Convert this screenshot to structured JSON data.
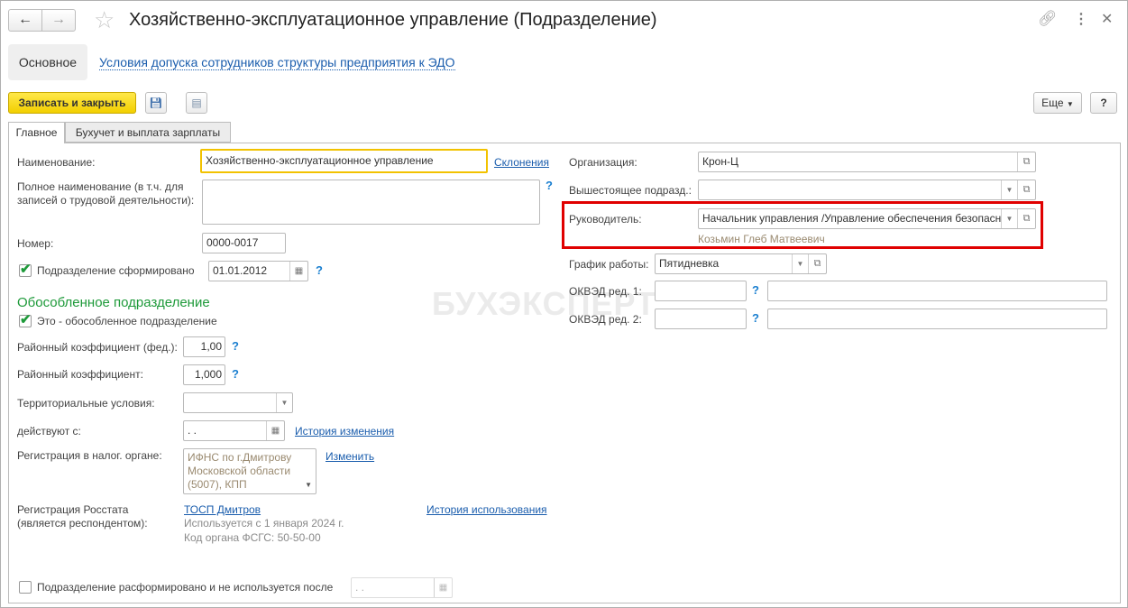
{
  "window": {
    "title": "Хозяйственно-эксплуатационное управление (Подразделение)"
  },
  "nav": {
    "main": "Основное",
    "link": "Условия допуска сотрудников структуры предприятия к ЭДО"
  },
  "toolbar": {
    "save_close": "Записать и закрыть",
    "more": "Еще",
    "help": "?"
  },
  "tabs": [
    {
      "label": "Главное"
    },
    {
      "label": "Бухучет и выплата зарплаты"
    }
  ],
  "left": {
    "name_label": "Наименование:",
    "name_value": "Хозяйственно-эксплуатационное управление",
    "declensions": "Склонения",
    "fullname_label1": "Полное наименование (в т.ч. для",
    "fullname_label2": "записей о трудовой деятельности):",
    "fullname_value": "",
    "number_label": "Номер:",
    "number_value": "0000-0017",
    "formed_label": "Подразделение сформировано",
    "formed_date": "01.01.2012",
    "section_title": "Обособленное подразделение",
    "separate_label": "Это - обособленное подразделение",
    "coef_fed_label": "Районный коэффициент (фед.):",
    "coef_fed_value": "1,00",
    "coef_label": "Районный коэффициент:",
    "coef_value": "1,000",
    "terr_label": "Территориальные условия:",
    "terr_value": "",
    "from_label": "действуют с:",
    "from_value": " .  .",
    "history_change": "История изменения",
    "tax_label": "Регистрация в налог. органе:",
    "tax_value1": "ИФНС по г.Дмитрову",
    "tax_value2": "Московской области",
    "tax_value3": "(5007), КПП",
    "tax_change": "Изменить",
    "rosstat_label1": "Регистрация Росстата",
    "rosstat_label2": "(является респондентом):",
    "rosstat_link": "ТОСП Дмитров",
    "rosstat_used": "Используется с 1 января 2024 г.",
    "rosstat_code": "Код органа ФСГС: 50-50-00",
    "history_use": "История использования",
    "disbanded_label": "Подразделение расформировано и не используется после",
    "disbanded_date": " .  ."
  },
  "right": {
    "org_label": "Организация:",
    "org_value": "Крон-Ц",
    "parent_label": "Вышестоящее подразд.:",
    "parent_value": "",
    "head_label": "Руководитель:",
    "head_value": "Начальник управления /Управление обеспечения безопасности",
    "head_name": "Козьмин Глеб Матвеевич",
    "schedule_label": "График работы:",
    "schedule_value": "Пятидневка",
    "okved1_label": "ОКВЭД ред. 1:",
    "okved2_label": "ОКВЭД ред. 2:"
  },
  "watermark": "БУХЭКСПЕРТ",
  "colors": {
    "accent_button": "#f5d60a",
    "link": "#1a5dad",
    "section": "#1e9a3a",
    "highlight": "#e00000"
  }
}
